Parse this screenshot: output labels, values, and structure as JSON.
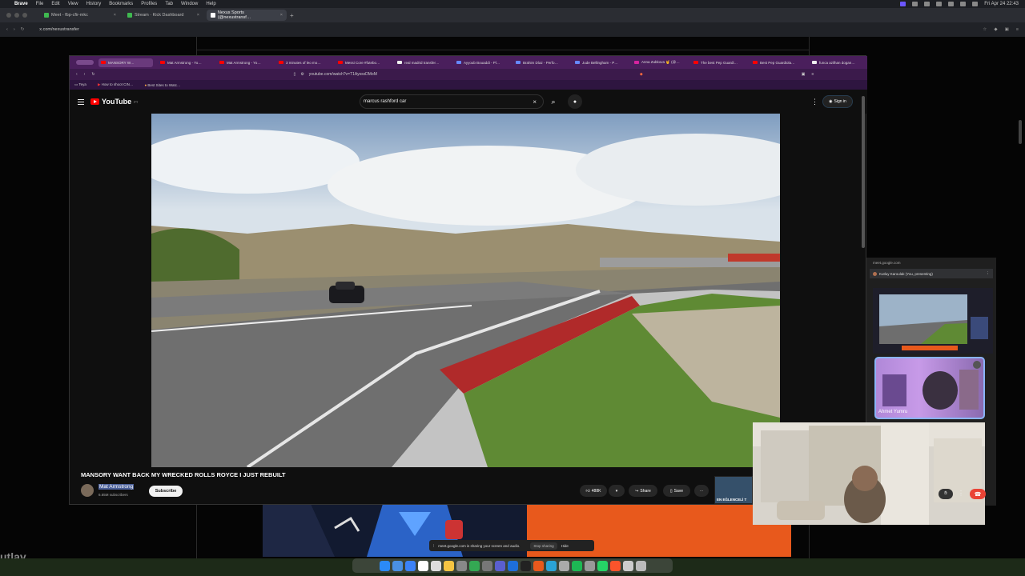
{
  "menubar": {
    "app": "Brave",
    "items": [
      "File",
      "Edit",
      "View",
      "History",
      "Bookmarks",
      "Profiles",
      "Tab",
      "Window",
      "Help"
    ],
    "clock": "Fri Apr 24  22:43"
  },
  "outer_tabs": [
    {
      "label": "Meet - fbp-cfir-mkc"
    },
    {
      "label": "Stream · Kick Dashboard"
    },
    {
      "label": "Nexus Sports (@nexustransf…"
    }
  ],
  "outer_url": "x.com/nexustransfer",
  "inner_tabs": [
    {
      "label": "MANSORY W…"
    },
    {
      "label": "Mat Armstrong - Yo…"
    },
    {
      "label": "Mat Armstrong - Yo…"
    },
    {
      "label": "3 minutes of leo mo…"
    },
    {
      "label": "Messi Core #futebo…"
    },
    {
      "label": "real madrid transfer…"
    },
    {
      "label": "Ayyoub Bouaddi - Pl…"
    },
    {
      "label": "Brahim Díaz - Perfo…"
    },
    {
      "label": "Jude Bellingham - P…"
    },
    {
      "label": "Anna Zubkova 🤘 (@…"
    },
    {
      "label": "The best Pep Guardi…"
    },
    {
      "label": "Best Pep Guardiola…"
    },
    {
      "label": "funca azilhan dogan…"
    }
  ],
  "inner_url": "youtube.com/watch?v=T1AyssxDMoM",
  "bookmarks": [
    "Teya",
    "How to shoot CIN…",
    "Best Sites to Watc…"
  ],
  "youtube": {
    "logo": "YouTube",
    "region": "PT",
    "search_value": "marcus rashford car",
    "sign_in": "Sign in",
    "title": "MANSORY WANT BACK MY WRECKED ROLLS ROYCE I JUST REBUILT",
    "channel": "Mat Armstrong",
    "subscribers": "6.65M subscribers",
    "subscribe": "Subscribe",
    "likes": "488K",
    "share": "Share",
    "save": "Save",
    "thumb_text": "EN EĞLENCELİ T"
  },
  "sharebar": {
    "text": "meet.google.com is sharing your screen and audio.",
    "stop": "Stop sharing",
    "hide": "Hide"
  },
  "meet": {
    "url": "meet.google.com",
    "presenting": "Kutluy Karoulak (You, presenting)",
    "participant": "Ahmet Yumru"
  },
  "left_text": "utlay"
}
